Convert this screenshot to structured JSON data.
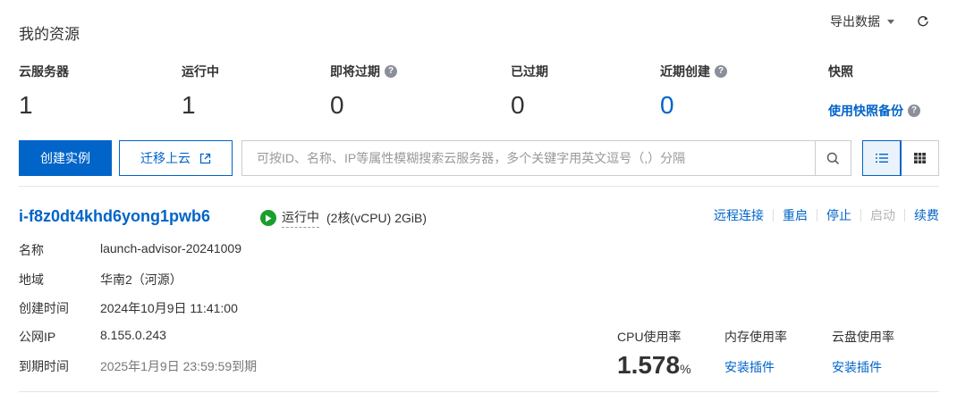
{
  "header": {
    "title": "我的资源",
    "export_label": "导出数据"
  },
  "stats": {
    "servers": {
      "label": "云服务器",
      "value": "1"
    },
    "running": {
      "label": "运行中",
      "value": "1"
    },
    "expiring": {
      "label": "即将过期",
      "value": "0"
    },
    "expired": {
      "label": "已过期",
      "value": "0"
    },
    "recent": {
      "label": "近期创建",
      "value": "0"
    },
    "snapshot": {
      "label": "快照",
      "link": "使用快照备份"
    }
  },
  "toolbar": {
    "create_label": "创建实例",
    "migrate_label": "迁移上云",
    "search_placeholder": "可按ID、名称、IP等属性模糊搜索云服务器，多个关键字用英文逗号（,）分隔"
  },
  "instance": {
    "id": "i-f8z0dt4khd6yong1pwb6",
    "status": "运行中",
    "spec": "(2核(vCPU) 2GiB)",
    "actions": {
      "remote": "远程连接",
      "restart": "重启",
      "stop": "停止",
      "start": "启动",
      "renew": "续费"
    },
    "fields": {
      "name": {
        "label": "名称",
        "value": "launch-advisor-20241009"
      },
      "region": {
        "label": "地域",
        "value": "华南2（河源）"
      },
      "created": {
        "label": "创建时间",
        "value": "2024年10月9日 11:41:00"
      },
      "ip": {
        "label": "公网IP",
        "value": "8.155.0.243"
      },
      "expiry": {
        "label": "到期时间",
        "value": "2025年1月9日 23:59:59到期"
      }
    },
    "metrics": {
      "cpu": {
        "label": "CPU使用率",
        "value": "1.578",
        "unit": "%"
      },
      "mem": {
        "label": "内存使用率",
        "link": "安装插件"
      },
      "disk": {
        "label": "云盘使用率",
        "link": "安装插件"
      }
    }
  },
  "colors": {
    "accent": "#0064c8",
    "running": "#1a9f2f"
  }
}
